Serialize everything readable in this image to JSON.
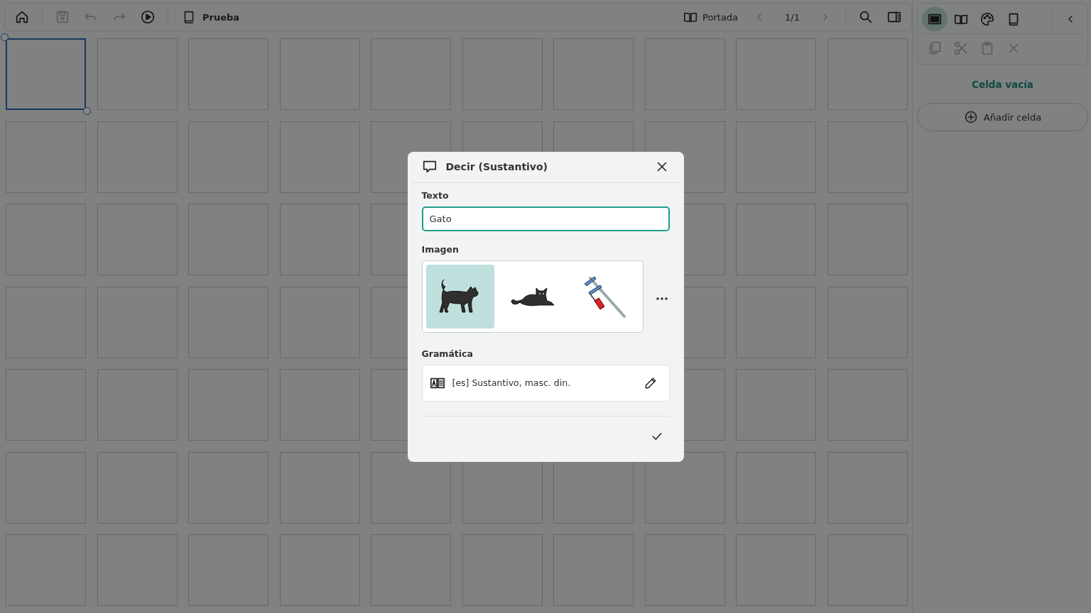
{
  "toolbar": {
    "buttons": [
      {
        "kind": "home",
        "disabled": false
      },
      {
        "kind": "save",
        "disabled": true
      },
      {
        "kind": "undo",
        "disabled": true
      },
      {
        "kind": "redo",
        "disabled": true
      },
      {
        "kind": "play",
        "disabled": false
      }
    ],
    "board": {
      "kind": "book",
      "title": "Prueba"
    },
    "page": {
      "label": "Portada",
      "indicator": "1/1",
      "prev_disabled": true,
      "next_disabled": true
    },
    "tools": [
      {
        "kind": "search"
      },
      {
        "kind": "panel"
      }
    ]
  },
  "grid": {
    "rows": [
      [
        {
          "selected": true
        },
        {
          "selected": false
        },
        {
          "selected": false
        },
        {
          "selected": false
        },
        {
          "selected": false
        },
        {
          "selected": false
        },
        {
          "selected": false
        },
        {
          "selected": false
        },
        {
          "selected": false
        },
        {
          "selected": false
        }
      ],
      [
        {
          "selected": false
        },
        {
          "selected": false
        },
        {
          "selected": false
        },
        {
          "selected": false
        },
        {
          "selected": false
        },
        {
          "selected": false
        },
        {
          "selected": false
        },
        {
          "selected": false
        },
        {
          "selected": false
        },
        {
          "selected": false
        }
      ],
      [
        {
          "selected": false
        },
        {
          "selected": false
        },
        {
          "selected": false
        },
        {
          "selected": false
        },
        {
          "selected": false
        },
        null,
        null,
        {
          "selected": false
        },
        {
          "selected": false
        },
        {
          "selected": false
        }
      ],
      [
        {
          "selected": false
        },
        {
          "selected": false
        },
        {
          "selected": false
        },
        {
          "selected": false
        },
        {
          "selected": false
        },
        null,
        null,
        {
          "selected": false
        },
        {
          "selected": false
        },
        {
          "selected": false
        }
      ],
      [
        {
          "selected": false
        },
        {
          "selected": false
        },
        {
          "selected": false
        },
        {
          "selected": false
        },
        {
          "selected": false
        },
        null,
        null,
        {
          "selected": false
        },
        {
          "selected": false
        },
        {
          "selected": false
        }
      ],
      [
        {
          "selected": false
        },
        {
          "selected": false
        },
        {
          "selected": false
        },
        {
          "selected": false
        },
        {
          "selected": false
        },
        {
          "selected": false
        },
        {
          "selected": false
        },
        {
          "selected": false
        },
        {
          "selected": false
        },
        {
          "selected": false
        }
      ],
      [
        {
          "selected": false
        },
        {
          "selected": false
        },
        {
          "selected": false
        },
        {
          "selected": false
        },
        {
          "selected": false
        },
        {
          "selected": false
        },
        {
          "selected": false
        },
        {
          "selected": false
        },
        {
          "selected": false
        },
        {
          "selected": false
        }
      ]
    ]
  },
  "sidebar": {
    "modes": [
      {
        "kind": "screen",
        "selected": true
      },
      {
        "kind": "openbook",
        "selected": false
      },
      {
        "kind": "palette",
        "selected": false
      },
      {
        "kind": "book",
        "selected": false
      }
    ],
    "edit_tools": [
      {
        "kind": "copy",
        "disabled": true
      },
      {
        "kind": "cut",
        "disabled": true
      },
      {
        "kind": "paste",
        "disabled": true
      },
      {
        "kind": "close",
        "disabled": true
      }
    ],
    "heading": "Celda vacía",
    "add_button": "Añadir celda"
  },
  "dialog": {
    "title": "Decir (Sustantivo)",
    "text_label": "Texto",
    "text_value": "Gato",
    "image_label": "Imagen",
    "images": [
      {
        "kind": "walkingcat",
        "selected": true
      },
      {
        "kind": "lyingcat",
        "selected": false
      },
      {
        "kind": "clamp",
        "selected": false
      }
    ],
    "grammar_label": "Gramática",
    "grammar_value": "[es] Sustantivo, masc. din."
  }
}
